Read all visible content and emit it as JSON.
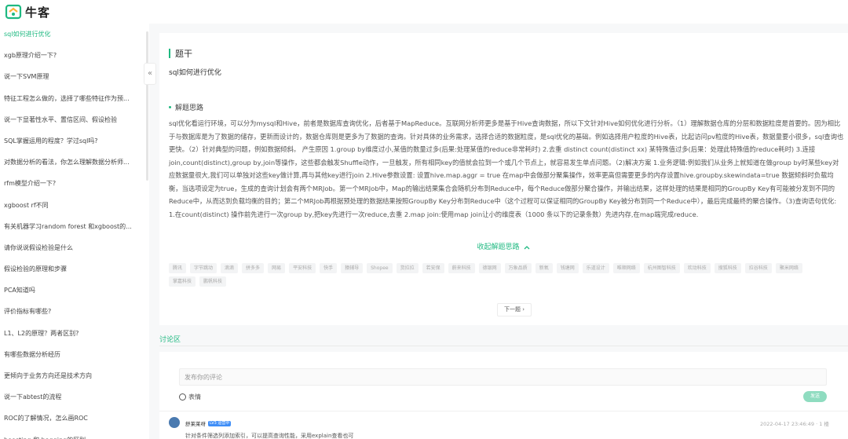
{
  "header": {
    "logo_text": "牛客"
  },
  "sidebar": {
    "collapse_icon": "«",
    "items": [
      {
        "label": "sql如何进行优化",
        "active": true
      },
      {
        "label": "xgb原理介绍一下?"
      },
      {
        "label": "说一下SVM原理"
      },
      {
        "label": "特征工程怎么做的，选择了哪些特征作为预..."
      },
      {
        "label": "说一下显著性水平、置信区间、假设检验"
      },
      {
        "label": "SQL掌握运用的程度？学过sql吗?"
      },
      {
        "label": "对数据分析的看法，你怎么理解数据分析师..."
      },
      {
        "label": "rfm模型介绍一下?"
      },
      {
        "label": "xgboost rf不同"
      },
      {
        "label": "有关机器学习random forest 和xgboost的..."
      },
      {
        "label": "请你说说假设检验是什么"
      },
      {
        "label": "假设检验的原理和步骤"
      },
      {
        "label": "PCA知道吗"
      },
      {
        "label": "评价指标有哪些?"
      },
      {
        "label": "L1、L2的原理？两者区别?"
      },
      {
        "label": "有哪些数据分析经历"
      },
      {
        "label": "更倾向于业务方向还是技术方向"
      },
      {
        "label": "说一下abtest的流程"
      },
      {
        "label": "ROC的了解情况，怎么画ROC"
      },
      {
        "label": "boosting 和 bagging的区别"
      }
    ]
  },
  "main": {
    "section_title": "题干",
    "question": "sql如何进行优化",
    "thought_title": "解题思路",
    "answer": "sql优化看运行环境，可以分为mysql和Hive，前者是数据库查询优化，后者基于MapReduce。互联网分析师更多是基于Hive查询数据，所以下文针对Hive如何优化进行分析。（1）理解数据仓库的分层和数据粒度是首要的。因为相比于与数据库是为了数据的储存，更新而设计的，数据仓库则是更多为了数据的查询。针对具体的业务需求，选择合适的数据粒度，是sql优化的基础。例如选择用户粒度的Hive表，比起访问pv粒度的Hive表，数据量要小很多，sql查询也更快。（2）针对典型的问题，例如数据倾斜。 产生原因 1.group by维度过小,某值的数量过多(后果:处理某值的reduce非常耗时) 2.去重 distinct count(distinct xx) 某特殊值过多(后果：处理此特殊值的reduce耗时) 3.连接 join,count(distinct),group by,join等操作，这些都会触发Shuffle动作，一旦触发，所有相同key的值就会拉到一个或几个节点上，就容易发生单点问题。（2)解决方案 1.业务逻辑:例如我们从业务上就知道在做group by时某些key对应数据量很大,我们可以单独对这些key做计算,再与其他key进行join 2.Hive参数设置: 设置hive.map.aggr = true 在map中会做部分聚集操作，效率更高但需要更多的内存设置hive.groupby.skewindata=true 数据倾斜时负载均衡，当选项设定为true，生成的查询计划会有两个MRJob。第一个MRJob中，Map的输出结果集合会随机分布到Reduce中，每个Reduce做部分聚合操作，并输出结果，这样处理的结果是相同的GroupBy Key有可能被分发到不同的Reduce中，从而达到负载均衡的目的；第二个MRJob再根据预处理的数据结果按照GroupBy Key分布到Reduce中（这个过程可以保证相同的GroupBy Key被分布到同一个Reduce中），最后完成最终的聚合操作。（3)查询语句优化: 1.在count(distinct) 操作前先进行一次group by,把key先进行一次reduce,去重 2.map join:使用map join让小的维度表（1000 条以下的记录条数）先进内存,在map端完成reduce.",
    "fold_label": "收起解题思路",
    "fold_icon": "chevron-up-icon",
    "tags": [
      "腾讯",
      "字节跳动",
      "滴滴",
      "拼多多",
      "网易",
      "平安科技",
      "快手",
      "猿辅导",
      "Shopee",
      "货拉拉",
      "若安保",
      "蔚来科技",
      "德银网",
      "万象品质",
      "新氧",
      "钱塘网",
      "乐道设计",
      "唯顺网络",
      "杭州图智科技",
      "欢动科技",
      "搜狐科技",
      "拉谷科技",
      "聚米网络",
      "掌嘉科技",
      "鹏帆科技"
    ],
    "next_label": "下一题 ›"
  },
  "discussion": {
    "label": "讨论区",
    "placeholder": "发布你的评论",
    "emoji_label": "表情",
    "send_label": "发送",
    "comment": {
      "user": "舒莱莱呀",
      "badge": "LV3 运营中",
      "time": "2022-04-17 23:46:49 · 1 楼",
      "text": "针对条件筛选列添加索引，可以提高查询性能，采用explain查看也可"
    }
  }
}
